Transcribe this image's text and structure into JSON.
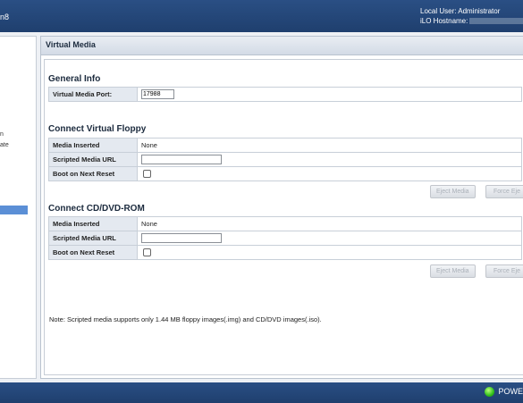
{
  "header": {
    "brand_fragment": "n8",
    "local_user_label": "Local User:",
    "local_user_value": "Administrator",
    "hostname_label": "iLO Hostname:"
  },
  "leftnav": {
    "fragments": [
      "n",
      "ate"
    ]
  },
  "page": {
    "title": "Virtual Media"
  },
  "general_info": {
    "heading": "General Info",
    "port_label": "Virtual Media Port:",
    "port_value": "17988"
  },
  "floppy": {
    "heading": "Connect Virtual Floppy",
    "media_inserted_label": "Media Inserted",
    "media_inserted_value": "None",
    "scripted_url_label": "Scripted Media URL",
    "scripted_url_value": "",
    "boot_label": "Boot on Next Reset",
    "eject_label": "Eject Media",
    "force_eject_label": "Force Eje"
  },
  "cdrom": {
    "heading": "Connect CD/DVD-ROM",
    "media_inserted_label": "Media Inserted",
    "media_inserted_value": "None",
    "scripted_url_label": "Scripted Media URL",
    "scripted_url_value": "",
    "boot_label": "Boot on Next Reset",
    "eject_label": "Eject Media",
    "force_eject_label": "Force Eje"
  },
  "note": "Note: Scripted media supports only 1.44 MB floppy images(.img) and CD/DVD images(.iso).",
  "footer": {
    "power_label": "POWE"
  }
}
